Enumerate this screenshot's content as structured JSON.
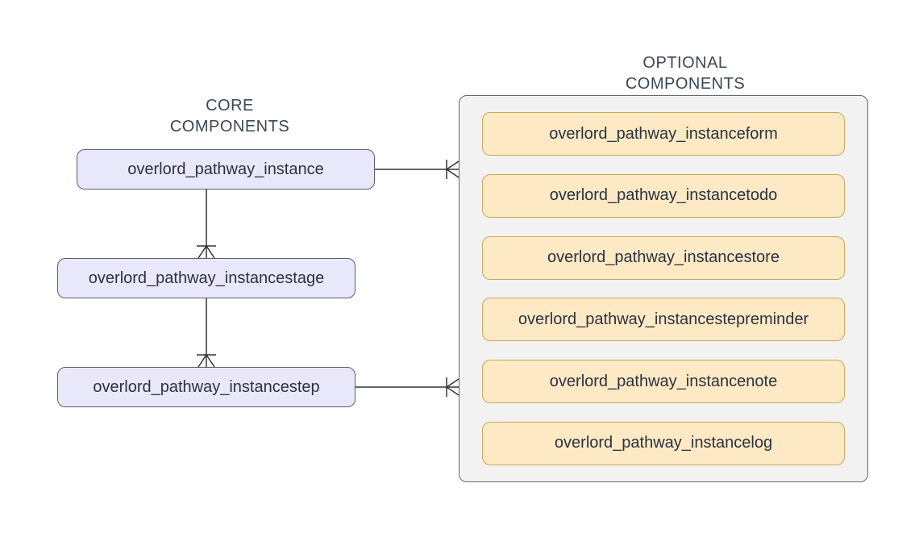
{
  "section_titles": {
    "core_line1": "CORE",
    "core_line2": "COMPONENTS",
    "optional_line1": "OPTIONAL",
    "optional_line2": "COMPONENTS"
  },
  "core_components": {
    "instance": "overlord_pathway_instance",
    "instancestage": "overlord_pathway_instancestage",
    "instancestep": "overlord_pathway_instancestep"
  },
  "optional_components": {
    "instanceform": "overlord_pathway_instanceform",
    "instancetodo": "overlord_pathway_instancetodo",
    "instancestore": "overlord_pathway_instancestore",
    "instancestepreminder": "overlord_pathway_instancestepreminder",
    "instancenote": "overlord_pathway_instancenote",
    "instancelog": "overlord_pathway_instancelog"
  },
  "colors": {
    "core_fill": "#e8e8fa",
    "core_stroke": "#5a5f73",
    "optional_fill": "#fde9c4",
    "optional_stroke": "#c9a85b",
    "container_fill": "#f2f2f2",
    "container_stroke": "#666666",
    "connector_stroke": "#333333",
    "text_color": "#3a4756"
  },
  "relationships": [
    {
      "from": "instance",
      "to": "instancestage",
      "type": "one-to-many"
    },
    {
      "from": "instancestage",
      "to": "instancestep",
      "type": "one-to-many"
    },
    {
      "from": "instance",
      "to": "optional-container",
      "type": "one-to-many"
    },
    {
      "from": "instancestep",
      "to": "optional-container",
      "type": "one-to-many"
    }
  ]
}
